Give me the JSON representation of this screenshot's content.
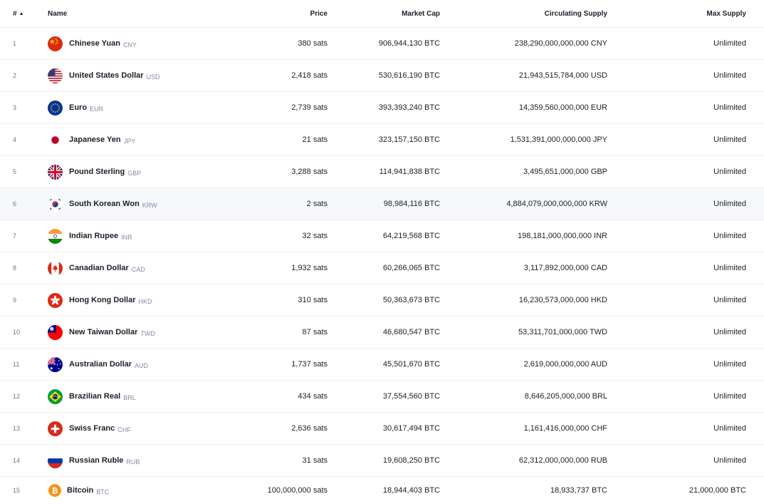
{
  "header": {
    "rank": "#",
    "name": "Name",
    "price": "Price",
    "market_cap": "Market Cap",
    "circulating_supply": "Circulating Supply",
    "max_supply": "Max Supply",
    "sort_icon": "caret-up-icon"
  },
  "rows": [
    {
      "rank": "1",
      "name": "Chinese Yuan",
      "code": "CNY",
      "price": "380 sats",
      "market_cap": "906,944,130 BTC",
      "supply": "238,290,000,000,000 CNY",
      "max": "Unlimited",
      "icon": "china-flag-icon"
    },
    {
      "rank": "2",
      "name": "United States Dollar",
      "code": "USD",
      "price": "2,418 sats",
      "market_cap": "530,616,190 BTC",
      "supply": "21,943,515,784,000 USD",
      "max": "Unlimited",
      "icon": "usa-flag-icon"
    },
    {
      "rank": "3",
      "name": "Euro",
      "code": "EUR",
      "price": "2,739 sats",
      "market_cap": "393,393,240 BTC",
      "supply": "14,359,560,000,000 EUR",
      "max": "Unlimited",
      "icon": "eu-flag-icon"
    },
    {
      "rank": "4",
      "name": "Japanese Yen",
      "code": "JPY",
      "price": "21 sats",
      "market_cap": "323,157,150 BTC",
      "supply": "1,531,391,000,000,000 JPY",
      "max": "Unlimited",
      "icon": "japan-flag-icon"
    },
    {
      "rank": "5",
      "name": "Pound Sterling",
      "code": "GBP",
      "price": "3,288 sats",
      "market_cap": "114,941,838 BTC",
      "supply": "3,495,651,000,000 GBP",
      "max": "Unlimited",
      "icon": "uk-flag-icon"
    },
    {
      "rank": "6",
      "name": "South Korean Won",
      "code": "KRW",
      "price": "2 sats",
      "market_cap": "98,984,116 BTC",
      "supply": "4,884,079,000,000,000 KRW",
      "max": "Unlimited",
      "icon": "south-korea-flag-icon"
    },
    {
      "rank": "7",
      "name": "Indian Rupee",
      "code": "INR",
      "price": "32 sats",
      "market_cap": "64,219,568 BTC",
      "supply": "198,181,000,000,000 INR",
      "max": "Unlimited",
      "icon": "india-flag-icon"
    },
    {
      "rank": "8",
      "name": "Canadian Dollar",
      "code": "CAD",
      "price": "1,932 sats",
      "market_cap": "60,266,065 BTC",
      "supply": "3,117,892,000,000 CAD",
      "max": "Unlimited",
      "icon": "canada-flag-icon"
    },
    {
      "rank": "9",
      "name": "Hong Kong Dollar",
      "code": "HKD",
      "price": "310 sats",
      "market_cap": "50,363,673 BTC",
      "supply": "16,230,573,000,000 HKD",
      "max": "Unlimited",
      "icon": "hong-kong-flag-icon"
    },
    {
      "rank": "10",
      "name": "New Taiwan Dollar",
      "code": "TWD",
      "price": "87 sats",
      "market_cap": "46,680,547 BTC",
      "supply": "53,311,701,000,000 TWD",
      "max": "Unlimited",
      "icon": "taiwan-flag-icon"
    },
    {
      "rank": "11",
      "name": "Australian Dollar",
      "code": "AUD",
      "price": "1,737 sats",
      "market_cap": "45,501,670 BTC",
      "supply": "2,619,000,000,000 AUD",
      "max": "Unlimited",
      "icon": "australia-flag-icon"
    },
    {
      "rank": "12",
      "name": "Brazilian Real",
      "code": "BRL",
      "price": "434 sats",
      "market_cap": "37,554,560 BTC",
      "supply": "8,646,205,000,000 BRL",
      "max": "Unlimited",
      "icon": "brazil-flag-icon"
    },
    {
      "rank": "13",
      "name": "Swiss Franc",
      "code": "CHF",
      "price": "2,636 sats",
      "market_cap": "30,617,494 BTC",
      "supply": "1,161,416,000,000 CHF",
      "max": "Unlimited",
      "icon": "switzerland-flag-icon"
    },
    {
      "rank": "14",
      "name": "Russian Ruble",
      "code": "RUB",
      "price": "31 sats",
      "market_cap": "19,608,250 BTC",
      "supply": "62,312,000,000,000 RUB",
      "max": "Unlimited",
      "icon": "russia-flag-icon"
    },
    {
      "rank": "15",
      "name": "Bitcoin",
      "code": "BTC",
      "price": "100,000,000 sats",
      "market_cap": "18,944,403 BTC",
      "supply": "18,933,737 BTC",
      "max": "21,000,000 BTC",
      "icon": "bitcoin-icon"
    }
  ],
  "colors": {
    "text": "#1b1f2a",
    "muted": "#7d8aa8",
    "divider": "#eff1f5",
    "highlight_row": "#f7f8fb",
    "bitcoin_orange": "#f7931a"
  }
}
